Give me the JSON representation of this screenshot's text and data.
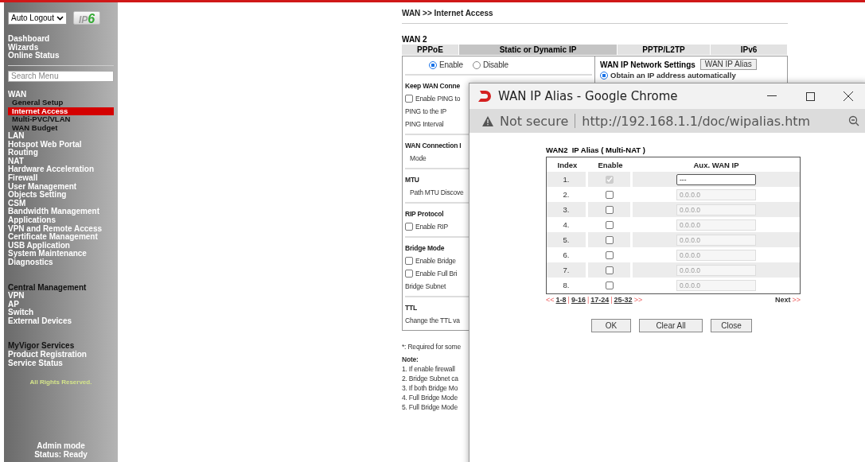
{
  "sidebar": {
    "auto_logout": "Auto Logout",
    "logo_text": "IP",
    "logo_digit": "6",
    "top_links": [
      "Dashboard",
      "Wizards",
      "Online Status"
    ],
    "search": {
      "placeholder": "Search Menu"
    },
    "menu": [
      {
        "label": "WAN",
        "kind": "link",
        "children": [
          {
            "label": "General Setup",
            "selected": false
          },
          {
            "label": "Internet Access",
            "selected": true
          },
          {
            "label": "Multi-PVC/VLAN",
            "selected": false
          },
          {
            "label": "WAN Budget",
            "selected": false
          }
        ]
      },
      {
        "label": "LAN",
        "kind": "link"
      },
      {
        "label": "Hotspot Web Portal",
        "kind": "link"
      },
      {
        "label": "Routing",
        "kind": "link"
      },
      {
        "label": "NAT",
        "kind": "link"
      },
      {
        "label": "Hardware Acceleration",
        "kind": "link"
      },
      {
        "label": "Firewall",
        "kind": "link"
      },
      {
        "label": "User Management",
        "kind": "link"
      },
      {
        "label": "Objects Setting",
        "kind": "link"
      },
      {
        "label": "CSM",
        "kind": "link"
      },
      {
        "label": "Bandwidth Management",
        "kind": "link"
      },
      {
        "label": "Applications",
        "kind": "link"
      },
      {
        "label": "VPN and Remote Access",
        "kind": "link"
      },
      {
        "label": "Certificate Management",
        "kind": "link"
      },
      {
        "label": "USB Application",
        "kind": "link"
      },
      {
        "label": "System Maintenance",
        "kind": "link"
      },
      {
        "label": "Diagnostics",
        "kind": "link"
      },
      {
        "label": "Central Management",
        "kind": "heading"
      },
      {
        "label": "VPN",
        "kind": "link"
      },
      {
        "label": "AP",
        "kind": "link"
      },
      {
        "label": "Switch",
        "kind": "link"
      },
      {
        "label": "External Devices",
        "kind": "link"
      },
      {
        "label": "MyVigor Services",
        "kind": "heading"
      },
      {
        "label": "Product Registration",
        "kind": "link"
      },
      {
        "label": "Service Status",
        "kind": "link"
      }
    ],
    "footer": "All Rights Reserved.",
    "status": [
      "Admin mode",
      "Status: Ready"
    ]
  },
  "main": {
    "breadcrumb": "WAN >> Internet Access",
    "wan_label": "WAN 2",
    "tabs": [
      {
        "label": "PPPoE",
        "selected": false
      },
      {
        "label": "Static or Dynamic IP",
        "selected": true
      },
      {
        "label": "PPTP/L2TP",
        "selected": false
      },
      {
        "label": "IPv6",
        "selected": false
      }
    ],
    "enable_options": [
      {
        "label": "Enable",
        "selected": true
      },
      {
        "label": "Disable",
        "selected": false
      }
    ],
    "sections": [
      {
        "title": "Keep WAN Conne",
        "rows": [
          {
            "kind": "checkbox",
            "label": "Enable PING to",
            "checked": false
          },
          {
            "kind": "text",
            "label": "PING to the IP"
          },
          {
            "kind": "text",
            "label": "PING Interval"
          }
        ]
      },
      {
        "title": "WAN Connection I",
        "rows": [
          {
            "kind": "indent",
            "label": "Mode"
          }
        ]
      },
      {
        "title": "MTU",
        "rows": [
          {
            "kind": "indent",
            "label": "Path MTU Discove"
          }
        ]
      },
      {
        "title": "RIP Protocol",
        "rows": [
          {
            "kind": "checkbox",
            "label": "Enable RIP",
            "checked": false
          }
        ]
      },
      {
        "title": "Bridge Mode",
        "rows": [
          {
            "kind": "checkbox",
            "label": "Enable Bridge",
            "checked": false
          },
          {
            "kind": "checkbox",
            "label": "Enable Full Bri",
            "checked": false
          },
          {
            "kind": "text",
            "label": "Bridge Subnet"
          }
        ]
      },
      {
        "title": "TTL",
        "rows": [
          {
            "kind": "text",
            "label": "Change the TTL va"
          }
        ]
      }
    ],
    "right": {
      "title": "WAN IP Network Settings",
      "button": "WAN IP Alias",
      "option": {
        "label": "Obtain an IP address automatically",
        "selected": true
      }
    },
    "required_note": "*: Required for some",
    "note_title": "Note:",
    "notes": [
      "1. If enable firewall",
      "2. Bridge Subnet ca",
      "3. If both Bridge Mo",
      "4. Full Bridge Mode",
      "5. Full Bridge Mode"
    ]
  },
  "popup": {
    "title": "WAN IP Alias - Google Chrome",
    "security": "Not secure",
    "url": "http://192.168.1.1/doc/wipalias.htm",
    "heading": "WAN2  IP Alias ( Multi-NAT )",
    "columns": [
      "Index",
      "Enable",
      "Aux. WAN IP"
    ],
    "rows": [
      {
        "index": "1.",
        "checked": true,
        "disabled": true,
        "editable": true,
        "ip": "---"
      },
      {
        "index": "2.",
        "checked": false,
        "disabled": false,
        "editable": false,
        "ip": "0.0.0.0"
      },
      {
        "index": "3.",
        "checked": false,
        "disabled": false,
        "editable": false,
        "ip": "0.0.0.0"
      },
      {
        "index": "4.",
        "checked": false,
        "disabled": false,
        "editable": false,
        "ip": "0.0.0.0"
      },
      {
        "index": "5.",
        "checked": false,
        "disabled": false,
        "editable": false,
        "ip": "0.0.0.0"
      },
      {
        "index": "6.",
        "checked": false,
        "disabled": false,
        "editable": false,
        "ip": "0.0.0.0"
      },
      {
        "index": "7.",
        "checked": false,
        "disabled": false,
        "editable": false,
        "ip": "0.0.0.0"
      },
      {
        "index": "8.",
        "checked": false,
        "disabled": false,
        "editable": false,
        "ip": "0.0.0.0"
      }
    ],
    "pager": {
      "prev": "<<",
      "links": [
        "1-8",
        "9-16",
        "17-24",
        "25-32"
      ],
      "separator": "|",
      "more": ">>",
      "next": "Next",
      "next_arrows": ">>"
    },
    "buttons": [
      "OK",
      "Clear All",
      "Close"
    ]
  }
}
